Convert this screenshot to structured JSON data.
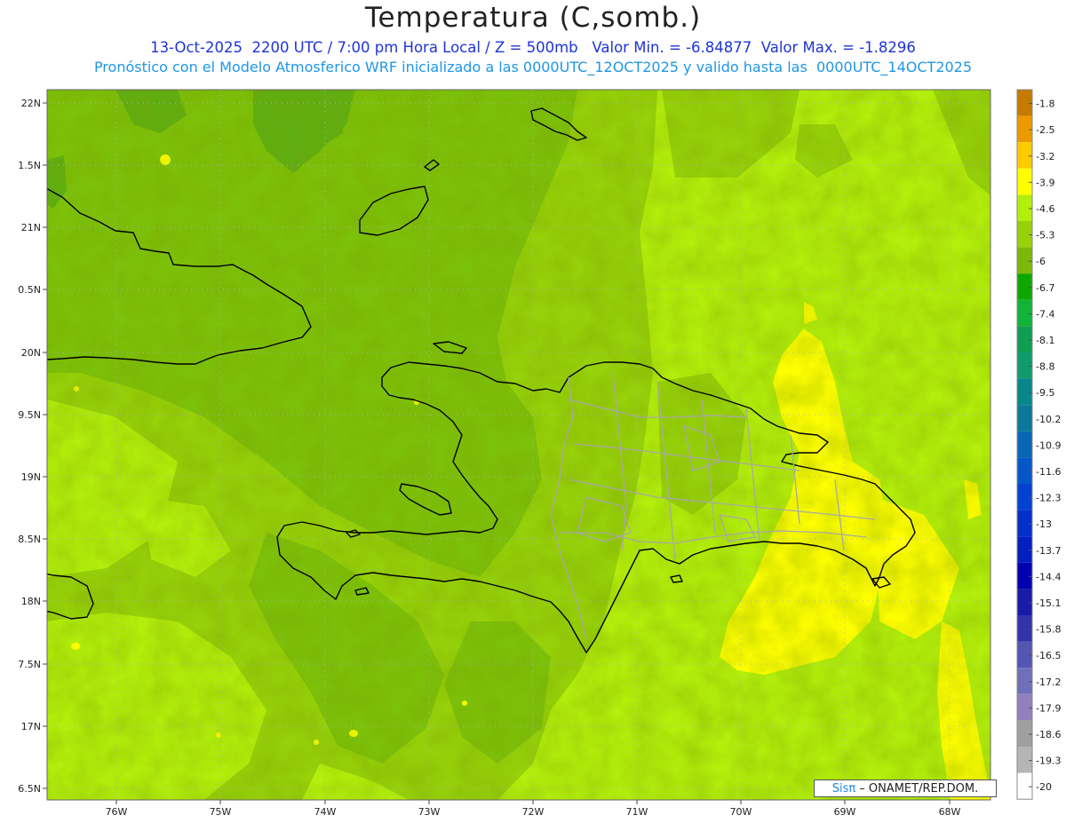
{
  "header": {
    "title": "Temperatura (C,somb.)",
    "line1": "13-Oct-2025  2200 UTC / 7:00 pm Hora Local / Z = 500mb   Valor Min. = -6.84877  Valor Max. = -1.8296",
    "line2": "Pronóstico con el Modelo Atmosferico WRF inicializado a las 0000UTC_12OCT2025 y valido hasta las  0000UTC_14OCT2025"
  },
  "map": {
    "lat_labels": [
      "22N",
      "1.5N",
      "21N",
      "0.5N",
      "20N",
      "9.5N",
      "19N",
      "8.5N",
      "18N",
      "7.5N",
      "17N",
      "6.5N"
    ],
    "lon_labels": [
      "76W",
      "75W",
      "74W",
      "73W",
      "72W",
      "71W",
      "70W",
      "69W",
      "68W"
    ],
    "colors": {
      "darker_green": "#5fae12",
      "dark_green": "#7cc10a",
      "mid_green": "#96d10a",
      "light_green": "#b3ee0c",
      "yellow": "#ffff00",
      "coast": "#000000",
      "provinces": "#a8a8a8"
    }
  },
  "colorbar": {
    "labels": [
      "-1.8",
      "-2.5",
      "-3.2",
      "-3.9",
      "-4.6",
      "-5.3",
      "-6",
      "-6.7",
      "-7.4",
      "-8.1",
      "-8.8",
      "-9.5",
      "-10.2",
      "-10.9",
      "-11.6",
      "-12.3",
      "-13",
      "-13.7",
      "-14.4",
      "-15.1",
      "-15.8",
      "-16.5",
      "-17.2",
      "-17.9",
      "-18.6",
      "-19.3",
      "-20"
    ],
    "colors": [
      "#c47b00",
      "#eb9a00",
      "#ffca00",
      "#ffff00",
      "#b3ee0c",
      "#96d10a",
      "#7cb80a",
      "#0ea700",
      "#11b338",
      "#0f9e52",
      "#109a6e",
      "#078789",
      "#0a7898",
      "#0767b5",
      "#0557c8",
      "#0341d2",
      "#0330cb",
      "#021fbf",
      "#0000b0",
      "#1a1aa8",
      "#3333aa",
      "#5555b2",
      "#7070ba",
      "#9080bd",
      "#a0a0a0",
      "#b5b5b5",
      "#ffffff"
    ]
  },
  "credit": {
    "brand": "Sisπ",
    "org": "– ONAMET/REP.DOM."
  }
}
